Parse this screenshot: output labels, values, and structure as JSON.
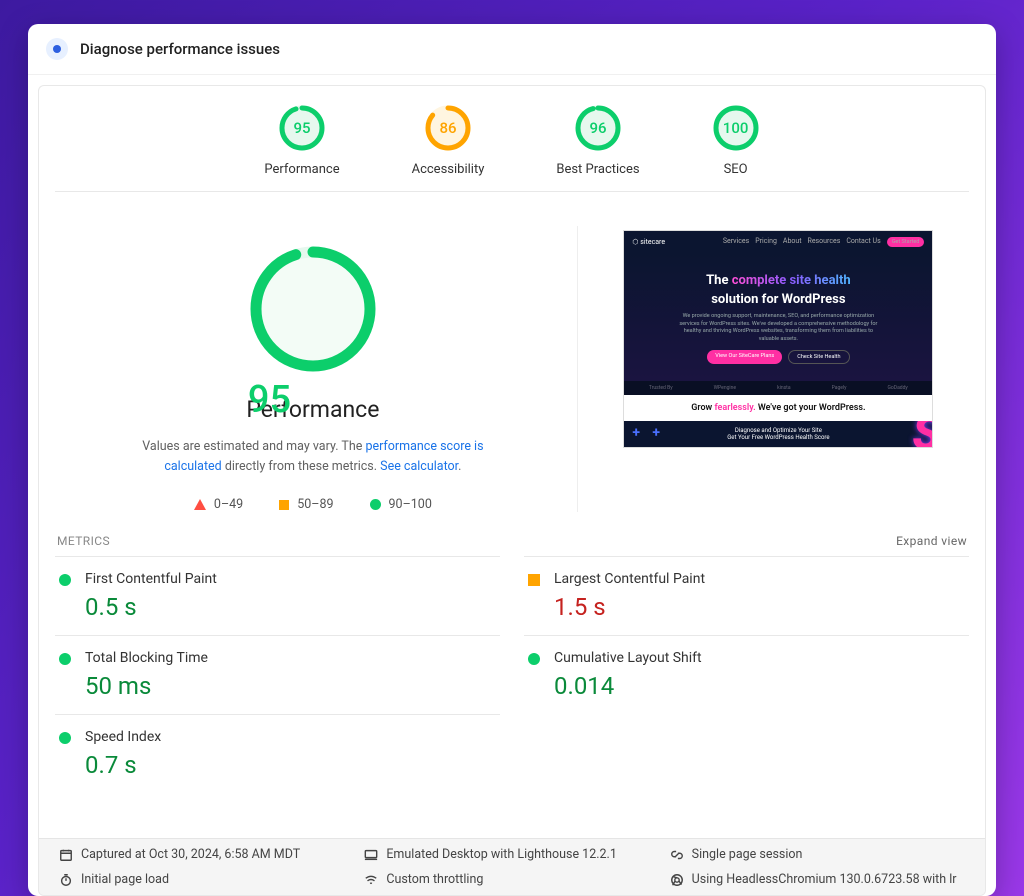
{
  "header": {
    "title": "Diagnose performance issues"
  },
  "categories": [
    {
      "label": "Performance",
      "score": 95,
      "status": "green"
    },
    {
      "label": "Accessibility",
      "score": 86,
      "status": "orange"
    },
    {
      "label": "Best Practices",
      "score": 96,
      "status": "green"
    },
    {
      "label": "SEO",
      "score": 100,
      "status": "green"
    }
  ],
  "main": {
    "score": 95,
    "title": "Performance",
    "desc_pre": "Values are estimated and may vary. The ",
    "desc_link1": "performance score is calculated",
    "desc_mid": " directly from these metrics. ",
    "desc_link2": "See calculator",
    "desc_post": "."
  },
  "legend": {
    "low": "0–49",
    "mid": "50–89",
    "high": "90–100"
  },
  "preview": {
    "brand": "sitecare",
    "nav": [
      "Services",
      "Pricing",
      "About",
      "Resources",
      "Contact Us"
    ],
    "cta": "Get Started",
    "hero_pre": "The ",
    "hero_grad": "complete site health",
    "hero_line2": "solution for WordPress",
    "hero_sub": "We provide ongoing support, maintenance, SEO, and performance optimization services for WordPress sites. We've developed a comprehensive methodology for healthy and thriving WordPress websites, transforming them from liabilities to valuable assets.",
    "btn1": "View Our SiteCare Plans",
    "btn2": "Check Site Health",
    "trust": [
      "Trusted By",
      "WPengine",
      "kinsta",
      "Pagely",
      "GoDaddy"
    ],
    "white_pre": "Grow ",
    "white_em": "fearlessly.",
    "white_post": " We've got your WordPress.",
    "foot1": "Diagnose and Optimize Your Site",
    "foot2": "Get Your Free WordPress Health Score"
  },
  "metrics_label": "METRICS",
  "expand_label": "Expand view",
  "metrics": [
    {
      "name": "First Contentful Paint",
      "value": "0.5 s",
      "status": "green",
      "valclass": "green"
    },
    {
      "name": "Largest Contentful Paint",
      "value": "1.5 s",
      "status": "orange",
      "valclass": "red"
    },
    {
      "name": "Total Blocking Time",
      "value": "50 ms",
      "status": "green",
      "valclass": "green"
    },
    {
      "name": "Cumulative Layout Shift",
      "value": "0.014",
      "status": "green",
      "valclass": "green"
    },
    {
      "name": "Speed Index",
      "value": "0.7 s",
      "status": "green",
      "valclass": "green"
    }
  ],
  "footer": {
    "captured": "Captured at Oct 30, 2024, 6:58 AM MDT",
    "emulated": "Emulated Desktop with Lighthouse 12.2.1",
    "session": "Single page session",
    "load": "Initial page load",
    "throttle": "Custom throttling",
    "browser": "Using HeadlessChromium 130.0.6723.58 with lr"
  },
  "colors": {
    "green": "#0cce6b",
    "orange": "#ffa400",
    "red": "#ff4e42"
  }
}
